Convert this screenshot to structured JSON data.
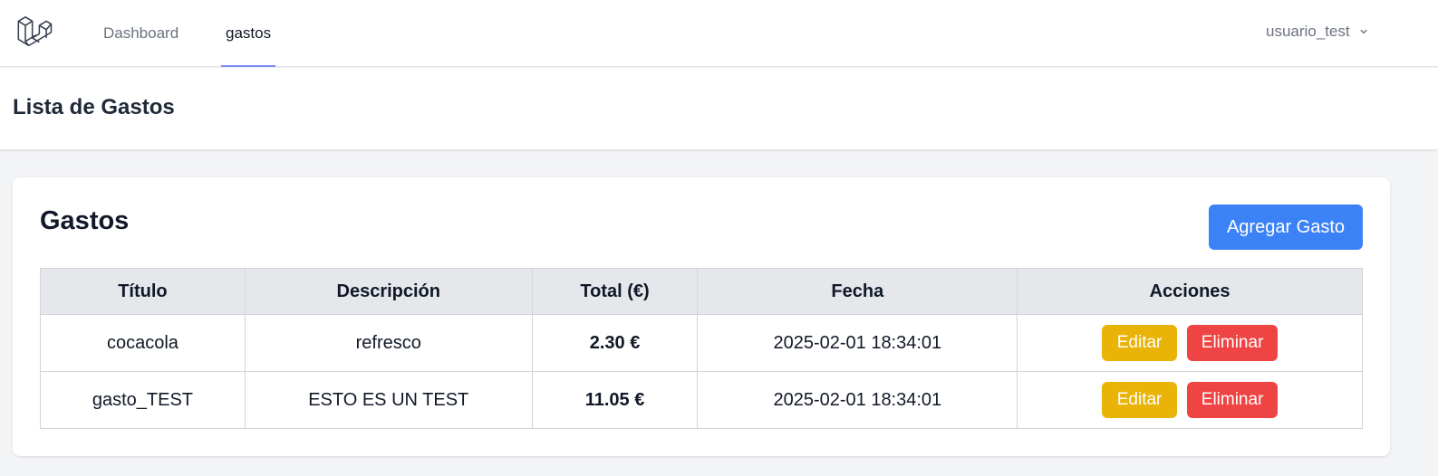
{
  "nav": {
    "logo_icon": "laravel-logo-icon",
    "links": [
      {
        "label": "Dashboard",
        "active": false
      },
      {
        "label": "gastos",
        "active": true
      }
    ],
    "user": {
      "name": "usuario_test",
      "icon": "chevron-down-icon"
    }
  },
  "header": {
    "title": "Lista de Gastos"
  },
  "card": {
    "title": "Gastos",
    "add_button": "Agregar Gasto",
    "table": {
      "columns": [
        "Título",
        "Descripción",
        "Total (€)",
        "Fecha",
        "Acciones"
      ],
      "rows": [
        {
          "titulo": "cocacola",
          "descripcion": "refresco",
          "total": "2.30 €",
          "fecha": "2025-02-01 18:34:01",
          "edit": "Editar",
          "delete": "Eliminar"
        },
        {
          "titulo": "gasto_TEST",
          "descripcion": "ESTO ES UN TEST",
          "total": "11.05 €",
          "fecha": "2025-02-01 18:34:01",
          "edit": "Editar",
          "delete": "Eliminar"
        }
      ]
    }
  },
  "colors": {
    "accent": "#3b82f6",
    "edit": "#eab308",
    "delete": "#ef4444",
    "total_text": "#16a34a",
    "nav_indicator": "#818cf8"
  }
}
